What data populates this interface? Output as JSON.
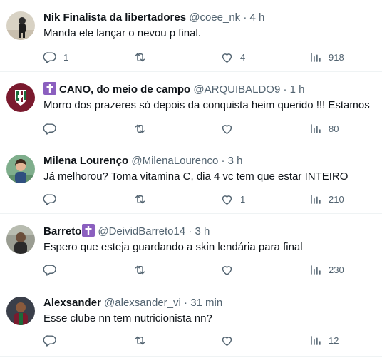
{
  "tweets": [
    {
      "name": "Nik Finalista da libertadores",
      "handle": "@coee_nk",
      "time": "4 h",
      "text": "Manda ele lançar o nevou p final.",
      "replies": "1",
      "retweets": "",
      "likes": "4",
      "views": "918"
    },
    {
      "name": "CANO, do meio de campo",
      "handle": "@ARQUIBALDO9",
      "time": "1 h",
      "text": "Morro dos prazeres só depois da conquista heim querido !!! Estamos",
      "replies": "",
      "retweets": "",
      "likes": "",
      "views": "80"
    },
    {
      "name": "Milena Lourenço",
      "handle": "@MilenaLourenco",
      "time": "3 h",
      "text": "Já melhorou? Toma vitamina C, dia 4 vc tem que estar INTEIRO",
      "replies": "",
      "retweets": "",
      "likes": "1",
      "views": "210"
    },
    {
      "name": "Barreto",
      "handle": "@DeividBarreto14",
      "time": "3 h",
      "text": "Espero que esteja guardando a skin lendária para final",
      "replies": "",
      "retweets": "",
      "likes": "",
      "views": "230"
    },
    {
      "name": "Alexsander",
      "handle": "@alexsander_vi",
      "time": "31 min",
      "text": "Esse clube nn tem nutricionista nn?",
      "replies": "",
      "retweets": "",
      "likes": "",
      "views": "12"
    }
  ],
  "separator": "·",
  "colors": {
    "text": "#0f1419",
    "muted": "#536471",
    "divider": "#eff3f4",
    "cross_badge": "#8b5fbf"
  },
  "icons": [
    "reply-icon",
    "retweet-icon",
    "like-icon",
    "views-icon",
    "cross-badge-icon"
  ]
}
